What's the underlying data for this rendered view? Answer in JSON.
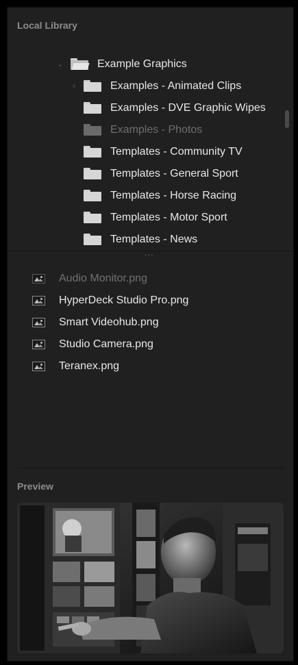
{
  "library": {
    "title": "Local Library",
    "tree": [
      {
        "label": "Example Graphics",
        "level": 0,
        "state": "expanded",
        "style": "normal"
      },
      {
        "label": "Examples - Animated Clips",
        "level": 1,
        "state": "collapsed",
        "style": "normal"
      },
      {
        "label": "Examples - DVE Graphic Wipes",
        "level": 1,
        "state": "leaf",
        "style": "normal"
      },
      {
        "label": "Examples - Photos",
        "level": 1,
        "state": "leaf",
        "style": "dim"
      },
      {
        "label": "Templates - Community TV",
        "level": 1,
        "state": "leaf",
        "style": "normal"
      },
      {
        "label": "Templates - General Sport",
        "level": 1,
        "state": "leaf",
        "style": "normal"
      },
      {
        "label": "Templates - Horse Racing",
        "level": 1,
        "state": "leaf",
        "style": "normal"
      },
      {
        "label": "Templates - Motor Sport",
        "level": 1,
        "state": "leaf",
        "style": "normal"
      },
      {
        "label": "Templates - News",
        "level": 1,
        "state": "leaf",
        "style": "normal"
      }
    ],
    "files": [
      {
        "label": "Audio Monitor.png",
        "style": "dim",
        "icon": "image-file-icon"
      },
      {
        "label": "HyperDeck Studio Pro.png",
        "style": "normal",
        "icon": "image-file-icon"
      },
      {
        "label": "Smart Videohub.png",
        "style": "normal",
        "icon": "image-file-icon"
      },
      {
        "label": "Studio Camera.png",
        "style": "normal",
        "icon": "image-file-icon"
      },
      {
        "label": "Teranex.png",
        "style": "normal",
        "icon": "image-file-icon"
      }
    ]
  },
  "preview": {
    "title": "Preview"
  },
  "colors": {
    "panel_bg": "#202020",
    "text": "#e8e8e8",
    "dim_text": "#6e6e6e",
    "section_title": "#8c8c8c"
  }
}
